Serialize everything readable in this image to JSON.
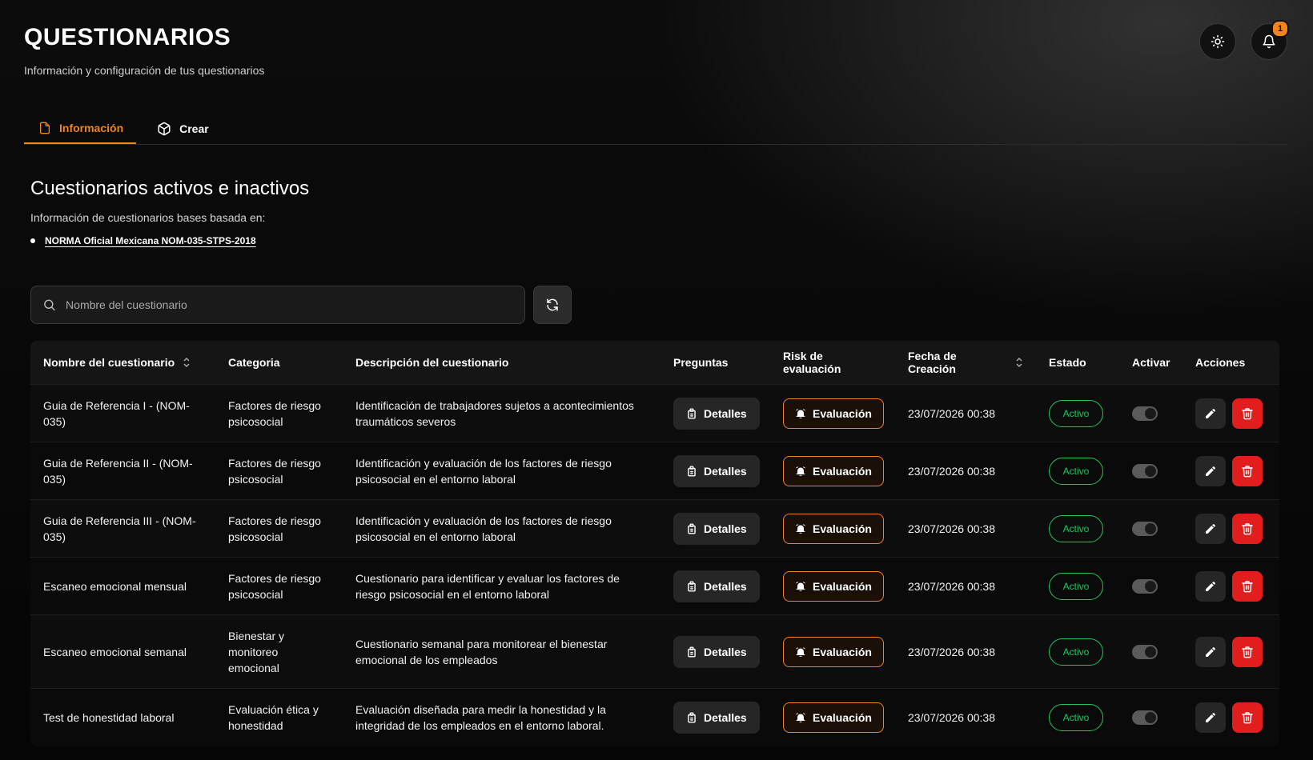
{
  "header": {
    "title": "QUESTIONARIOS",
    "subtitle": "Información y configuración de tus questionarios",
    "notification_count": "1"
  },
  "tabs": [
    {
      "label": "Información"
    },
    {
      "label": "Crear"
    }
  ],
  "section": {
    "title": "Cuestionarios activos e inactivos",
    "description": "Información de cuestionarios bases basada en:",
    "references": [
      "NORMA Oficial Mexicana NOM-035-STPS-2018"
    ]
  },
  "search": {
    "placeholder": "Nombre del cuestionario",
    "value": ""
  },
  "table": {
    "columns": {
      "name": "Nombre del cuestionario",
      "category": "Categoria",
      "description": "Descripción del cuestionario",
      "questions": "Preguntas",
      "risk": "Risk de evaluación",
      "date": "Fecha de Creación",
      "status": "Estado",
      "activate": "Activar",
      "actions": "Acciones"
    },
    "details_label": "Detalles",
    "eval_label": "Evaluación",
    "rows": [
      {
        "name": "Guia de Referencia I - (NOM-035)",
        "category": "Factores de riesgo psicosocial",
        "description": "Identificación de trabajadores sujetos a acontecimientos traumáticos severos",
        "date": "23/07/2026 00:38",
        "status": "Activo"
      },
      {
        "name": "Guia de Referencia II - (NOM-035)",
        "category": "Factores de riesgo psicosocial",
        "description": "Identificación y evaluación de los factores de riesgo psicosocial en el entorno laboral",
        "date": "23/07/2026 00:38",
        "status": "Activo"
      },
      {
        "name": "Guia de Referencia III - (NOM-035)",
        "category": "Factores de riesgo psicosocial",
        "description": "Identificación y evaluación de los factores de riesgo psicosocial en el entorno laboral",
        "date": "23/07/2026 00:38",
        "status": "Activo"
      },
      {
        "name": "Escaneo emocional mensual",
        "category": "Factores de riesgo psicosocial",
        "description": "Cuestionario para identificar y evaluar los factores de riesgo psicosocial en el entorno laboral",
        "date": "23/07/2026 00:38",
        "status": "Activo"
      },
      {
        "name": "Escaneo emocional semanal",
        "category": "Bienestar y monitoreo emocional",
        "description": "Cuestionario semanal para monitorear el bienestar emocional de los empleados",
        "date": "23/07/2026 00:38",
        "status": "Activo"
      },
      {
        "name": "Test de honestidad laboral",
        "category": "Evaluación ética y honestidad",
        "description": "Evaluación diseñada para medir la honestidad y la integridad de los empleados en el entorno laboral.",
        "date": "23/07/2026 00:38",
        "status": "Activo"
      }
    ]
  },
  "colors": {
    "accent": "#f0841f",
    "active_green": "#22c55e",
    "danger_red": "#e11d1d"
  }
}
